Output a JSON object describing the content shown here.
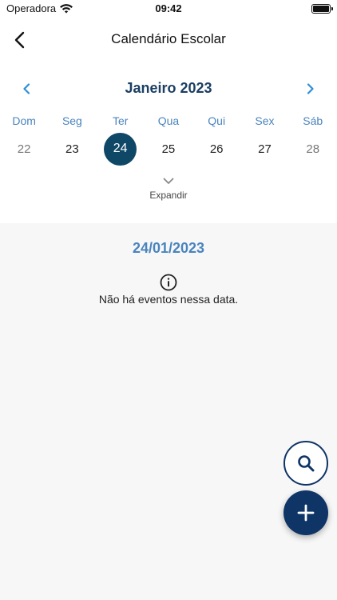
{
  "status_bar": {
    "carrier": "Operadora",
    "time": "09:42"
  },
  "header": {
    "title": "Calendário Escolar"
  },
  "calendar": {
    "month_label": "Janeiro 2023",
    "weekdays": [
      "Dom",
      "Seg",
      "Ter",
      "Qua",
      "Qui",
      "Sex",
      "Sáb"
    ],
    "days": [
      "22",
      "23",
      "24",
      "25",
      "26",
      "27",
      "28"
    ],
    "selected_day": "24",
    "expand_label": "Expandir"
  },
  "events": {
    "selected_date": "24/01/2023",
    "empty_message": "Não há eventos nessa data."
  },
  "colors": {
    "accent_blue": "#4a84bd",
    "dark_navy": "#0f3466",
    "selected_day": "#0f4766",
    "month_title": "#1b3f63"
  },
  "icons": [
    "back-arrow-icon",
    "chevron-left-icon",
    "chevron-right-icon",
    "chevron-down-icon",
    "info-icon",
    "search-icon",
    "plus-icon",
    "wifi-icon",
    "battery-icon"
  ]
}
